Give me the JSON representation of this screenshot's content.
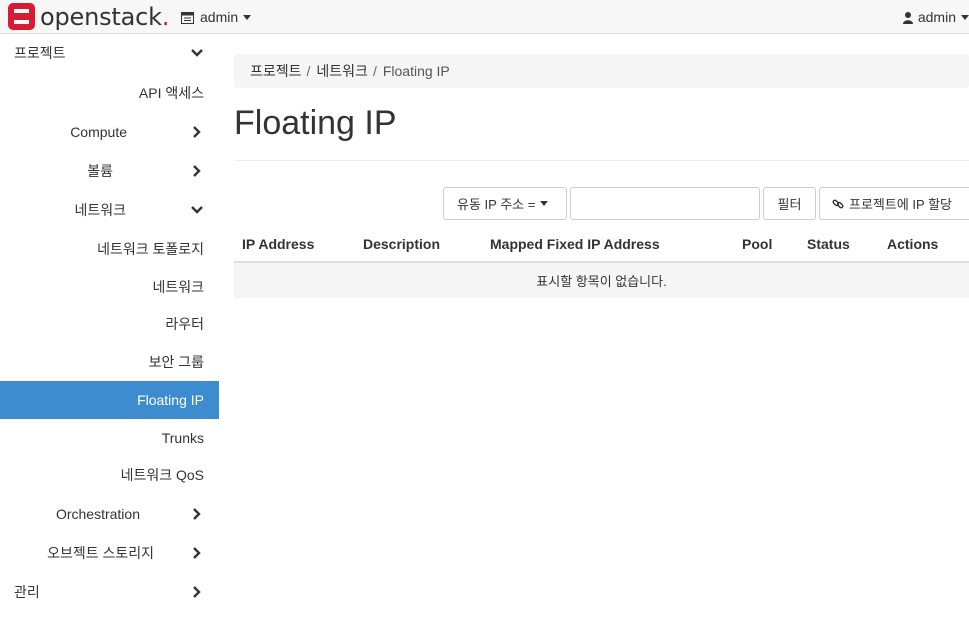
{
  "header": {
    "brand": "openstack",
    "brand_dot": ".",
    "project_selector": "admin",
    "user_menu": "admin"
  },
  "sidebar": {
    "items": [
      {
        "label": "프로젝트",
        "chevron": "down"
      },
      {
        "label": "API 액세스"
      },
      {
        "label": "Compute",
        "chevron": "right"
      },
      {
        "label": "볼륨",
        "chevron": "right"
      },
      {
        "label": "네트워크",
        "chevron": "down"
      },
      {
        "label": "네트워크 토폴로지"
      },
      {
        "label": "네트워크"
      },
      {
        "label": "라우터"
      },
      {
        "label": "보안 그룹"
      },
      {
        "label": "Floating IP",
        "active": true
      },
      {
        "label": "Trunks"
      },
      {
        "label": "네트워크 QoS"
      },
      {
        "label": "Orchestration",
        "chevron": "right"
      },
      {
        "label": "오브젝트 스토리지",
        "chevron": "right"
      },
      {
        "label": "관리",
        "chevron": "right"
      }
    ]
  },
  "breadcrumb": {
    "items": [
      "프로젝트",
      "네트워크",
      "Floating IP"
    ],
    "separator": "/"
  },
  "page": {
    "title": "Floating IP"
  },
  "toolbar": {
    "filter_field": "유동 IP 주소 =",
    "filter_value": "",
    "filter_button": "필터",
    "allocate_button": "프로젝트에 IP 할당"
  },
  "table": {
    "columns": [
      "IP Address",
      "Description",
      "Mapped Fixed IP Address",
      "Pool",
      "Status",
      "Actions"
    ],
    "rows": [],
    "empty_message": "표시할 항목이 없습니다."
  },
  "colors": {
    "active_nav": "#3d8ccf",
    "brand_red": "#da1a32"
  },
  "icons": {
    "logo": "openstack-logo-icon",
    "project": "project-grid-icon",
    "user": "user-icon",
    "link": "link-icon"
  }
}
